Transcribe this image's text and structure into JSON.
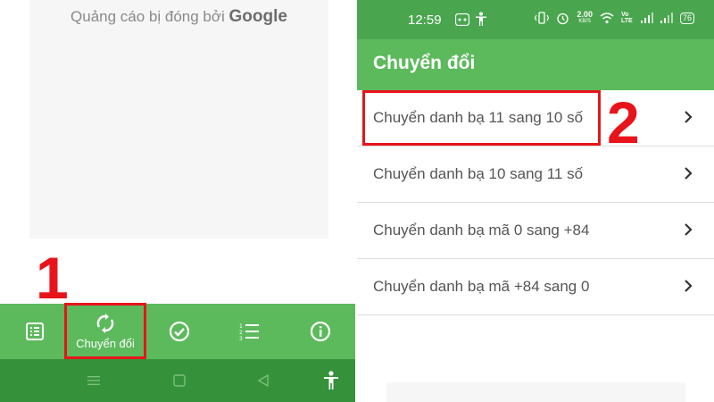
{
  "left_screen": {
    "ad": {
      "text": "Quảng cáo bị đóng bởi",
      "brand": "Google"
    },
    "step_marker": "1",
    "bottom_nav": [
      {
        "id": "list",
        "icon": "list-icon",
        "label": ""
      },
      {
        "id": "convert",
        "icon": "sync-icon",
        "label": "Chuyển đổi",
        "active": true
      },
      {
        "id": "check",
        "icon": "check-circle-icon",
        "label": ""
      },
      {
        "id": "numbered",
        "icon": "numbered-list-icon",
        "label": ""
      },
      {
        "id": "info",
        "icon": "info-icon",
        "label": ""
      }
    ],
    "system_nav": [
      "menu-icon",
      "home-square-icon",
      "back-triangle-icon",
      "accessibility-icon"
    ]
  },
  "right_screen": {
    "status_bar": {
      "time": "12:59",
      "speed_value": "2.00",
      "speed_unit": "KB/S",
      "network_label": "Vo LTE",
      "battery": "76"
    },
    "app_title": "Chuyển đổi",
    "step_marker": "2",
    "items": [
      {
        "label": "Chuyển danh bạ 11 sang 10 số",
        "highlighted": true
      },
      {
        "label": "Chuyển danh bạ 10 sang 11 số"
      },
      {
        "label": "Chuyển danh bạ mã 0 sang +84"
      },
      {
        "label": "Chuyển danh bạ mã +84 sang 0"
      }
    ]
  },
  "colors": {
    "green": "#5cba5c",
    "dark_green": "#35923a",
    "status_green": "#4aa64e",
    "highlight_red": "#e8141b"
  }
}
